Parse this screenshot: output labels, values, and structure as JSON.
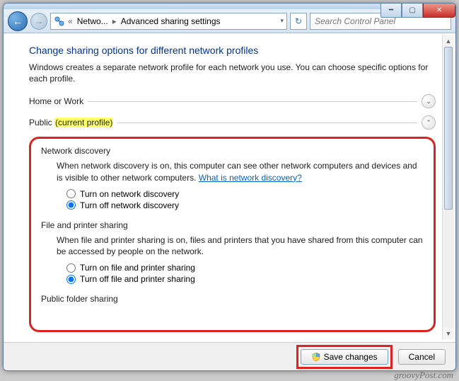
{
  "window": {
    "breadcrumbs": {
      "item1": "Netwo...",
      "item2": "Advanced sharing settings"
    },
    "search_placeholder": "Search Control Panel"
  },
  "page": {
    "title": "Change sharing options for different network profiles",
    "description": "Windows creates a separate network profile for each network you use. You can choose specific options for each profile."
  },
  "sections": {
    "home_label": "Home or Work",
    "public_label": "Public",
    "public_suffix": "(current profile)"
  },
  "network_discovery": {
    "heading": "Network discovery",
    "description": "When network discovery is on, this computer can see other network computers and devices and is visible to other network computers. ",
    "link": "What is network discovery?",
    "opt_on": "Turn on network discovery",
    "opt_off": "Turn off network discovery",
    "selected": "off"
  },
  "file_printer": {
    "heading": "File and printer sharing",
    "description": "When file and printer sharing is on, files and printers that you have shared from this computer can be accessed by people on the network.",
    "opt_on": "Turn on file and printer sharing",
    "opt_off": "Turn off file and printer sharing",
    "selected": "off"
  },
  "public_folder": {
    "heading": "Public folder sharing"
  },
  "footer": {
    "save": "Save changes",
    "cancel": "Cancel"
  },
  "watermark": "groovyPost.com"
}
